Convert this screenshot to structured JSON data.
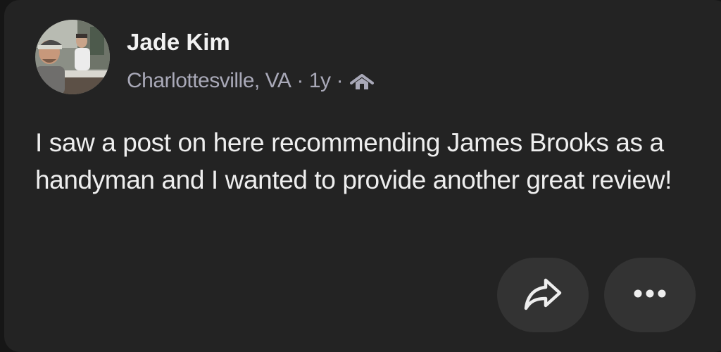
{
  "post": {
    "author": {
      "name": "Jade Kim",
      "avatar_icon": "profile-photo"
    },
    "meta": {
      "location": "Charlottesville, VA",
      "separator": "·",
      "time_ago": "1y",
      "audience_icon": "neighborhood-home-icon"
    },
    "body": "I saw a post on here recommending James Brooks as a handyman and I wanted to provide another great review!",
    "actions": {
      "share_icon": "share-arrow-icon",
      "more_icon": "more-options-icon"
    }
  },
  "colors": {
    "background": "#232323",
    "page": "#161616",
    "primary_text": "#eeeeee",
    "secondary_text": "#a9a9b8",
    "button_bg": "#333333"
  }
}
